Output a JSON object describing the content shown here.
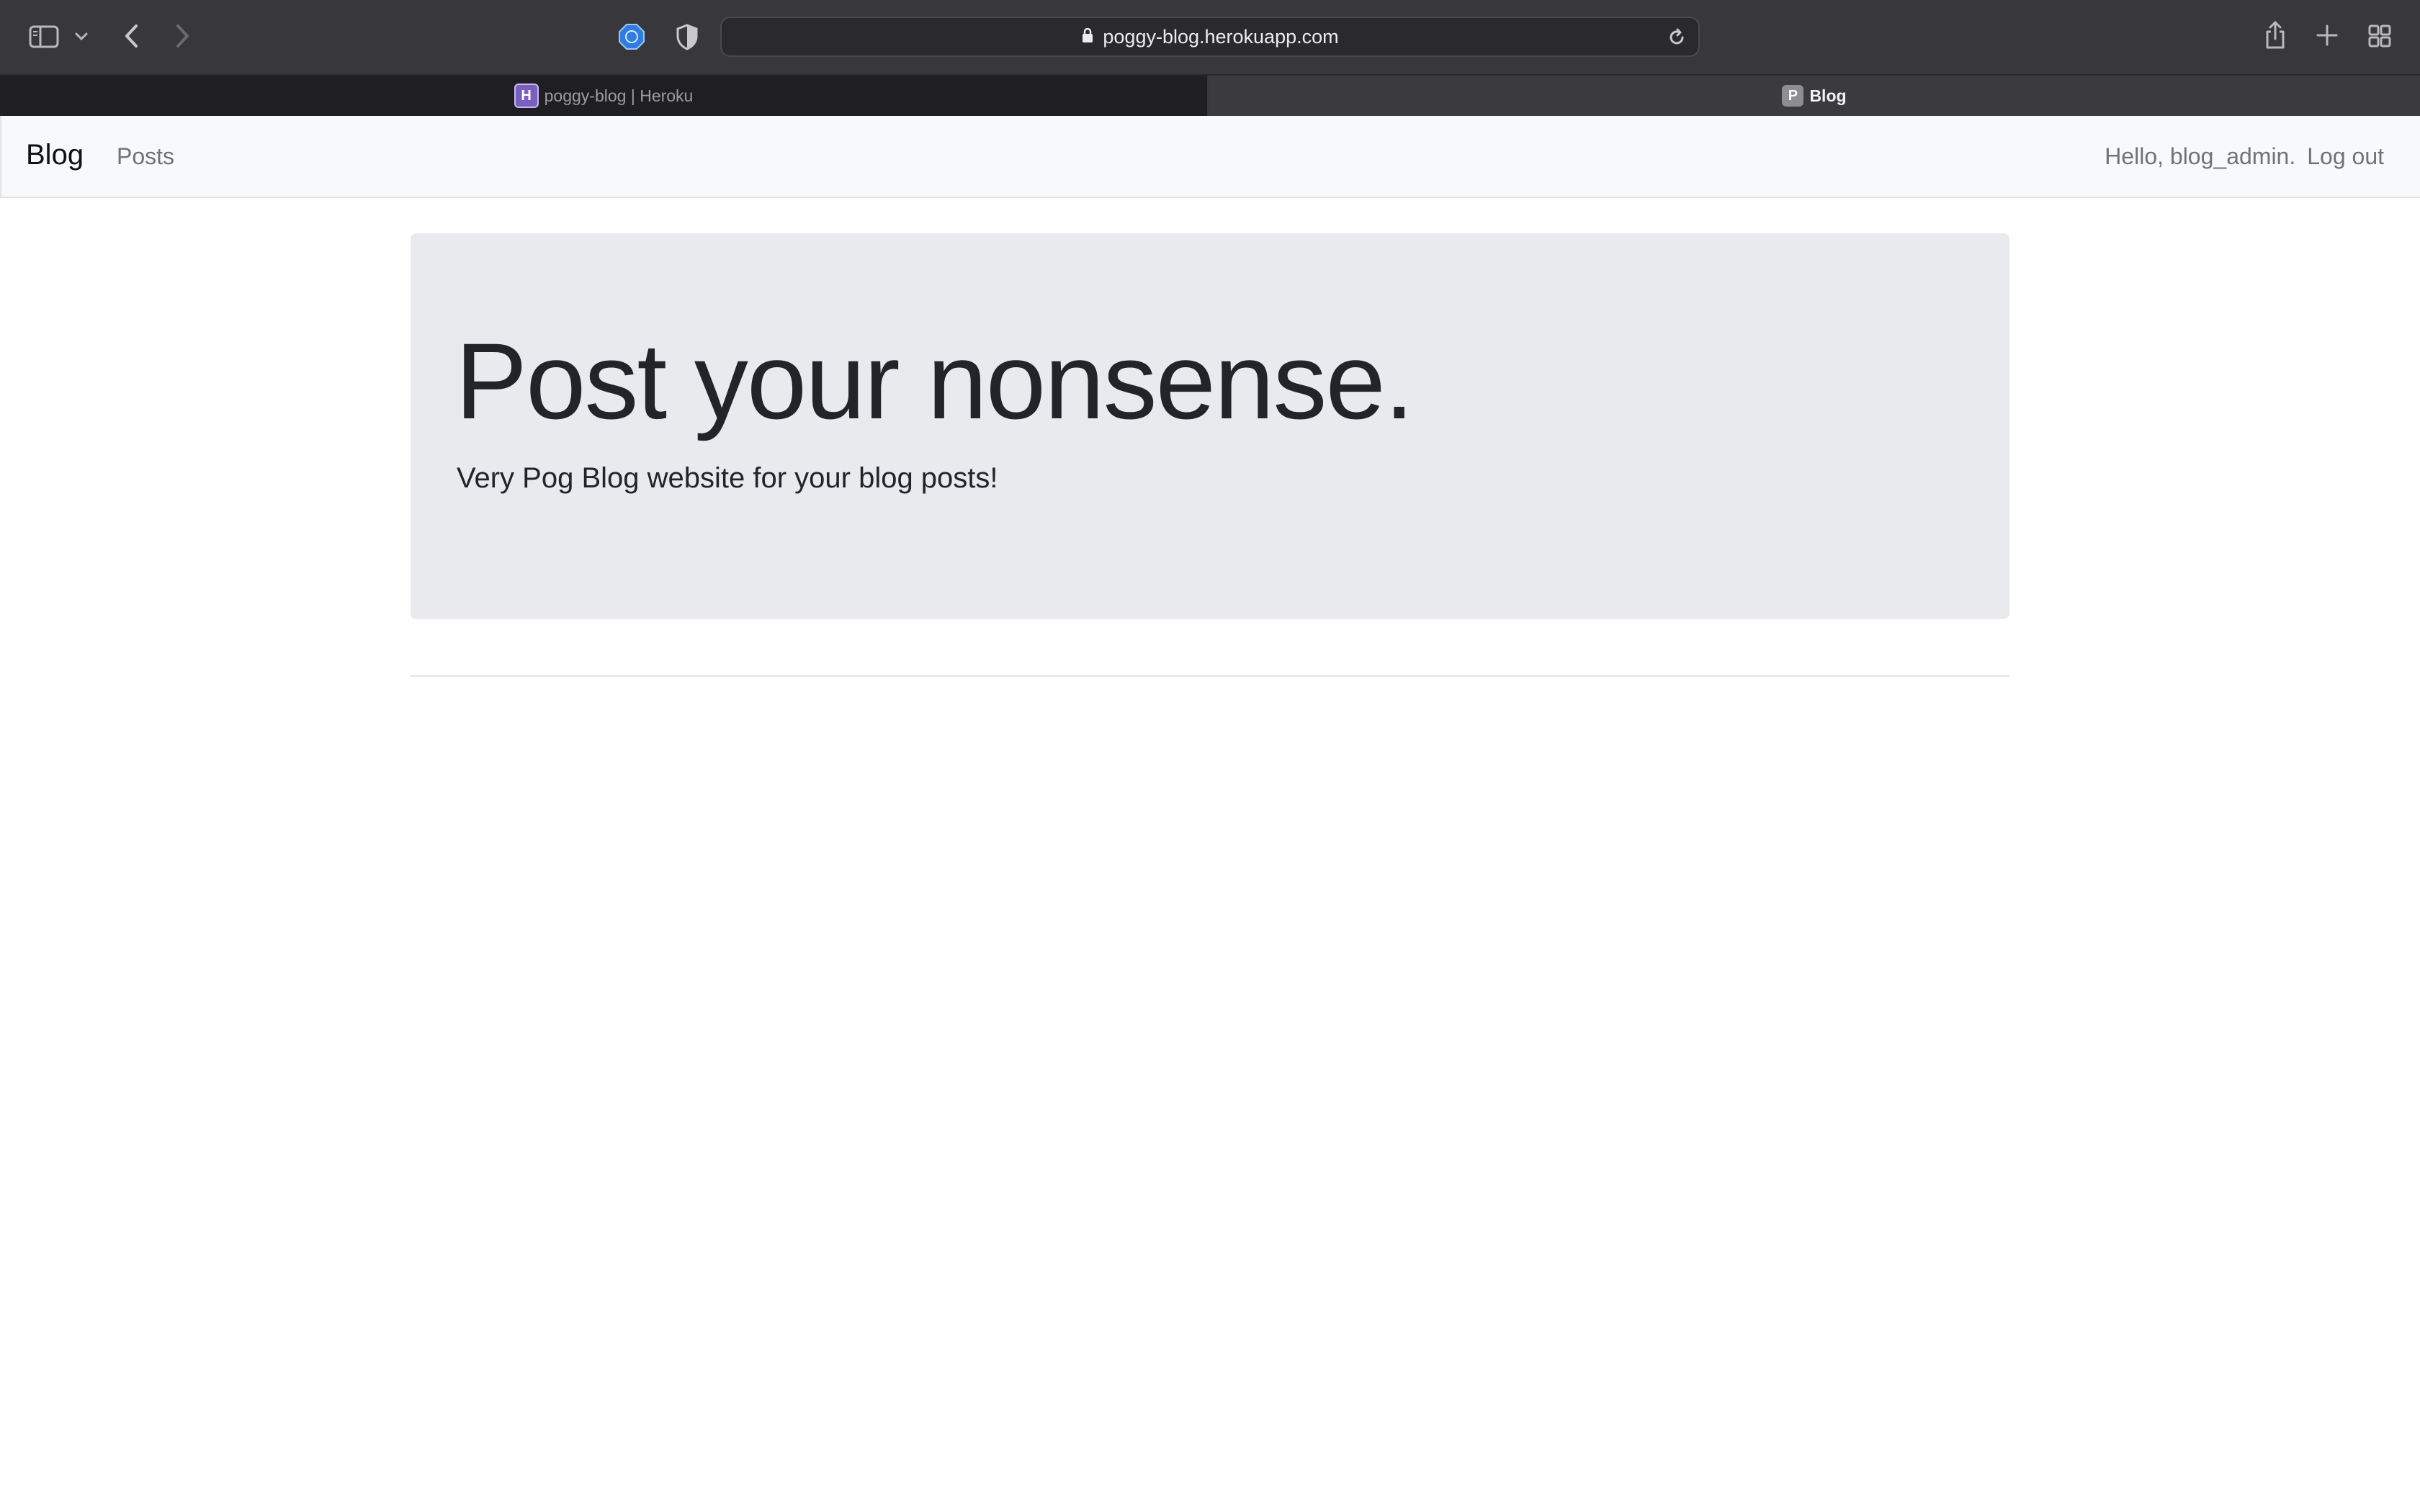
{
  "browser": {
    "address": "poggy-blog.herokuapp.com",
    "tabs": [
      {
        "label": "poggy-blog | Heroku",
        "favicon": "heroku-favicon",
        "active": false
      },
      {
        "label": "Blog",
        "favicon": "P",
        "active": true
      }
    ],
    "icons": [
      "sidebar-icon",
      "chevron-down-icon",
      "back-icon",
      "forward-icon",
      "extension-icon",
      "privacy-shield-icon",
      "lock-icon",
      "reload-icon",
      "share-icon",
      "new-tab-icon",
      "tab-overview-icon"
    ]
  },
  "navbar": {
    "brand": "Blog",
    "posts_link": "Posts",
    "greeting": "Hello, blog_admin.",
    "logout": "Log out"
  },
  "hero": {
    "heading": "Post your nonsense.",
    "lead": "Very Pog Blog website for your blog posts!"
  },
  "colors": {
    "chrome_bg": "#38373c",
    "navbar_bg": "#f8f9fa",
    "jumbotron_bg": "#e9eaee",
    "text_dark": "#212428",
    "nav_muted": "#707275"
  }
}
